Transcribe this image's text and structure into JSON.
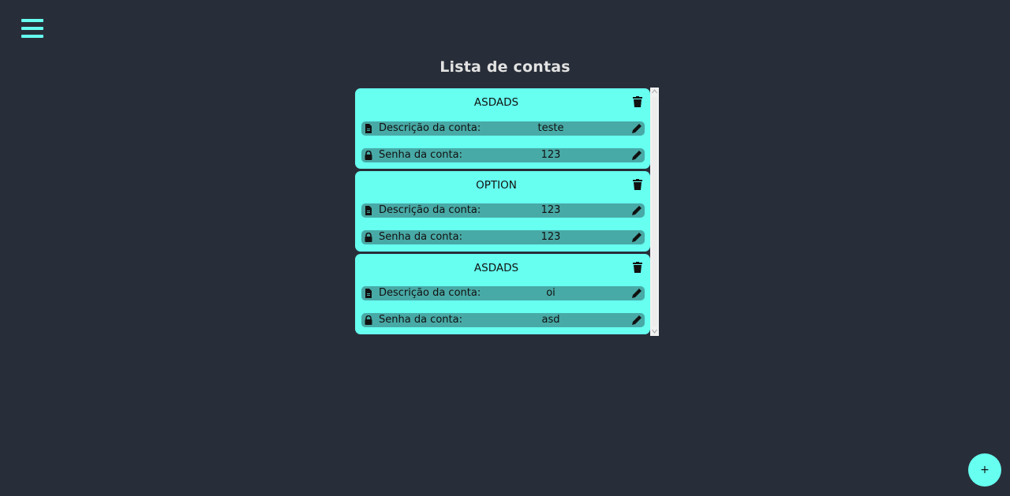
{
  "header": {
    "title": "Lista de contas"
  },
  "accounts": [
    {
      "name": "ASDADS",
      "description_label": "Descrição da conta:",
      "description_value": "teste",
      "password_label": "Senha da conta:",
      "password_value": "123"
    },
    {
      "name": "OPTION",
      "description_label": "Descrição da conta:",
      "description_value": "123",
      "password_label": "Senha da conta:",
      "password_value": "123"
    },
    {
      "name": "ASDADS",
      "description_label": "Descrição da conta:",
      "description_value": "oi",
      "password_label": "Senha da conta:",
      "password_value": "asd"
    }
  ],
  "fab": {
    "label": "+"
  },
  "icons": {
    "menu": "hamburger-menu-icon",
    "delete": "trash-icon",
    "description": "document-icon",
    "password": "lock-icon",
    "edit": "pencil-icon"
  },
  "colors": {
    "background": "#282e39",
    "accent": "#66fff0",
    "row": "#48aaa6",
    "title": "#e2e2e2"
  }
}
